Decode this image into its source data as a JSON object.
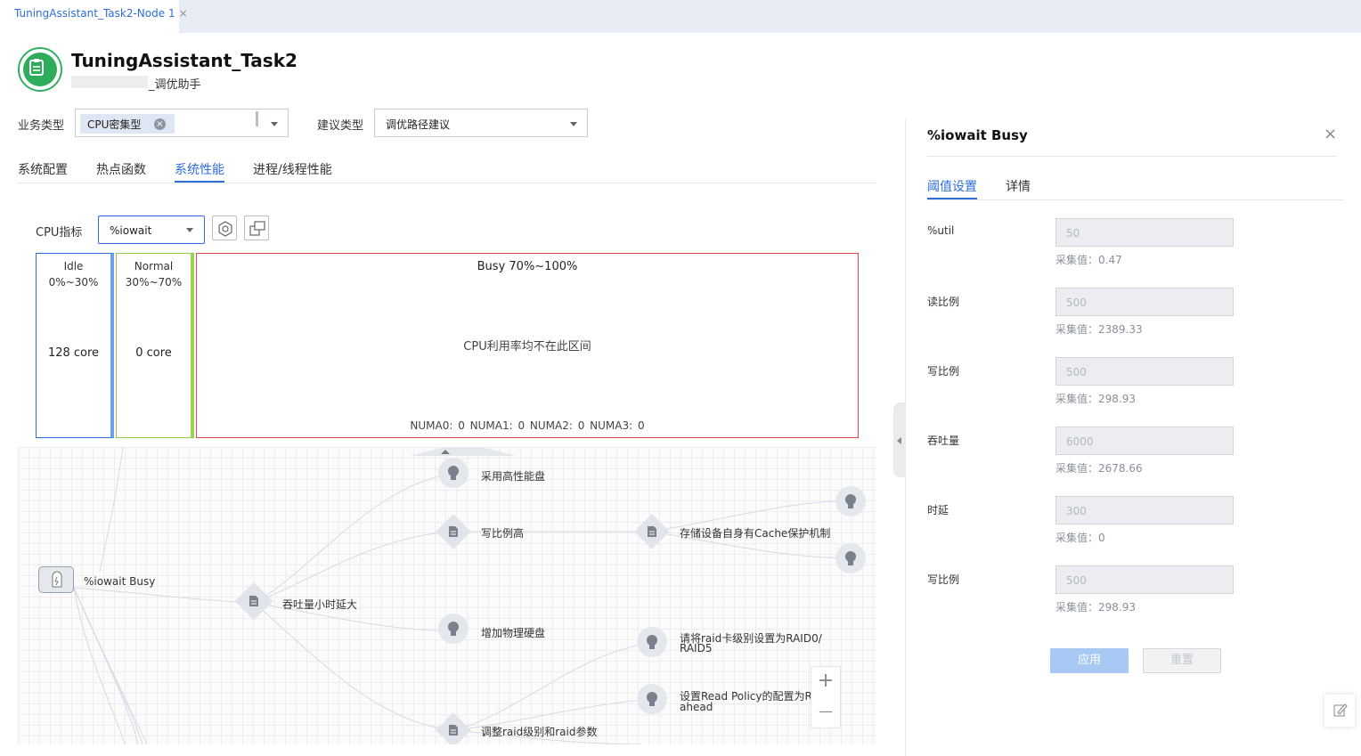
{
  "tabbar": {
    "tab_label": "TuningAssistant_Task2-Node 1",
    "close_glyph": "×"
  },
  "header": {
    "title": "TuningAssistant_Task2",
    "subtitle": "_调优助手"
  },
  "filters": {
    "biz_type_label": "业务类型",
    "biz_type_chip": "CPU密集型",
    "suggest_type_label": "建议类型",
    "suggest_type_value": "调优路径建议"
  },
  "tabs": [
    "系统配置",
    "热点函数",
    "系统性能",
    "进程/线程性能"
  ],
  "active_tab": "系统性能",
  "cpu": {
    "metric_label": "CPU指标",
    "metric_value": "%iowait"
  },
  "usage": {
    "idle": {
      "name": "Idle",
      "range": "0%~30%",
      "count": "128 core"
    },
    "normal": {
      "name": "Normal",
      "range": "30%~70%",
      "count": "0 core"
    },
    "busy": {
      "title": "Busy 70%~100%",
      "message": "CPU利用率均不在此区间",
      "numa": "NUMA0: 0  NUMA1: 0  NUMA2: 0  NUMA3: 0"
    }
  },
  "graph": {
    "root": "%iowait Busy",
    "n_throughput": "吞吐量小时延大",
    "n_high_perf_disk": "采用高性能盘",
    "n_write_ratio": "写比例高",
    "n_cache_protect": "存储设备自身有Cache保护机制",
    "n_add_disk": "增加物理硬盘",
    "n_raid_level_l1": "请将raid卡级别设置为RAID0/",
    "n_raid_level_l2": "RAID5",
    "n_read_policy_l1": "设置Read Policy的配置为Re",
    "n_read_policy_l2": "ahead",
    "n_adjust_raid": "调整raid级别和raid参数",
    "zoom_in": "+",
    "zoom_out": "—"
  },
  "panel": {
    "title": "%iowait Busy",
    "close_glyph": "×",
    "tabs": [
      "阈值设置",
      "详情"
    ],
    "fields": [
      {
        "label": "%util",
        "value": "50",
        "collected": "采集值：0.47"
      },
      {
        "label": "读比例",
        "value": "500",
        "collected": "采集值：2389.33"
      },
      {
        "label": "写比例",
        "value": "500",
        "collected": "采集值：298.93"
      },
      {
        "label": "吞吐量",
        "value": "6000",
        "collected": "采集值：2678.66"
      },
      {
        "label": "时延",
        "value": "300",
        "collected": "采集值：0"
      },
      {
        "label": "写比例",
        "value": "500",
        "collected": "采集值：298.93"
      }
    ],
    "apply_label": "应用",
    "reset_label": "重置"
  },
  "colors": {
    "accent": "#2e6ddb",
    "idle_border": "#2e6ddb",
    "normal_border": "#8fcc3e",
    "busy_border": "#e0484a",
    "logo_green": "#2fac5c"
  }
}
